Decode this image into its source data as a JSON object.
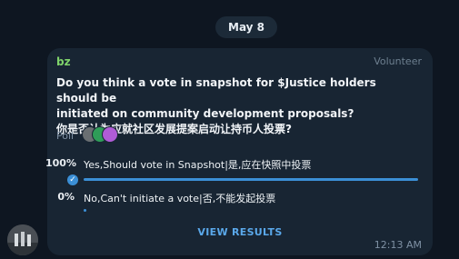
{
  "date_separator": "May 8",
  "message": {
    "sender": "bz",
    "role": "Volunteer",
    "question_lines": [
      "Do you think a vote in snapshot for $Justice holders should be",
      "initiated on community development proposals?",
      "你是否认为应就社区发展提案启动让持币人投票?"
    ],
    "poll_type": "Poll",
    "options": [
      {
        "percent": "100%",
        "text": "Yes,Should vote in Snapshot|是,应在快照中投票",
        "fill": 1.0,
        "chosen": true
      },
      {
        "percent": "0%",
        "text": "No,Can't initiate a vote|否,不能发起投票",
        "fill": 0.0,
        "chosen": false
      }
    ],
    "view_results_label": "VIEW RESULTS",
    "time": "12:13 AM"
  },
  "colors": {
    "background": "#0e1621",
    "bubble": "#182533",
    "sender_name": "#7fd36b",
    "accent": "#3b8fd6"
  },
  "icons": {
    "check": "check-circle-icon",
    "voters": [
      "voter-avatar-icon",
      "voter-avatar-icon",
      "voter-avatar-icon"
    ]
  }
}
